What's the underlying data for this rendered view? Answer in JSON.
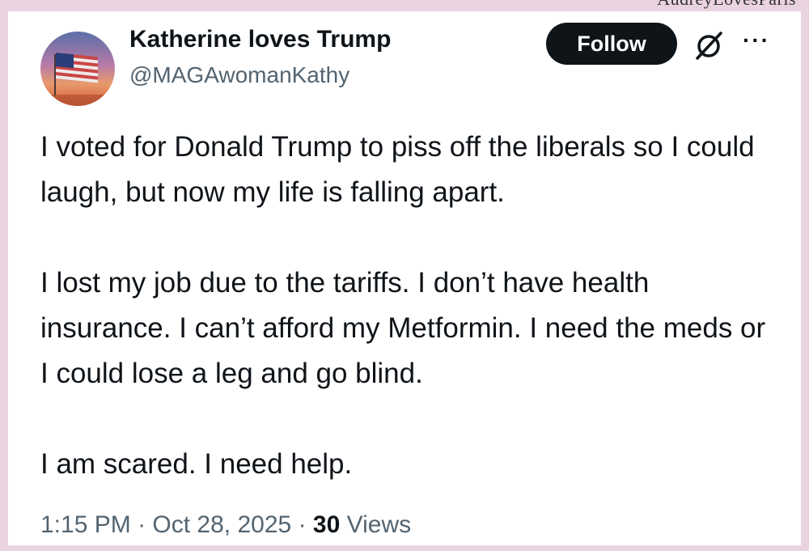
{
  "watermark": "AudreyLovesParis",
  "author": {
    "name": "Katherine loves Trump",
    "handle": "@MAGAwomanKathy"
  },
  "actions": {
    "follow_label": "Follow",
    "grok_icon": "grok-icon",
    "more_icon": "more-icon",
    "more_glyph": "···"
  },
  "tweet": {
    "paragraphs": [
      "I voted for Donald Trump to piss off the liberals so I could laugh, but now my life is falling apart.",
      "I lost my job due to the tariffs. I don’t have health insurance. I can’t afford my Metformin. I need the meds or I could lose a leg and go blind.",
      "I am scared. I need help."
    ]
  },
  "meta": {
    "time": "1:15 PM",
    "separator": "·",
    "date": "Oct 28, 2025",
    "views_count": "30",
    "views_label": "Views"
  },
  "colors": {
    "background": "#ead3e0",
    "text_primary": "#0f1419",
    "text_secondary": "#536471",
    "follow_bg": "#0f1419"
  }
}
